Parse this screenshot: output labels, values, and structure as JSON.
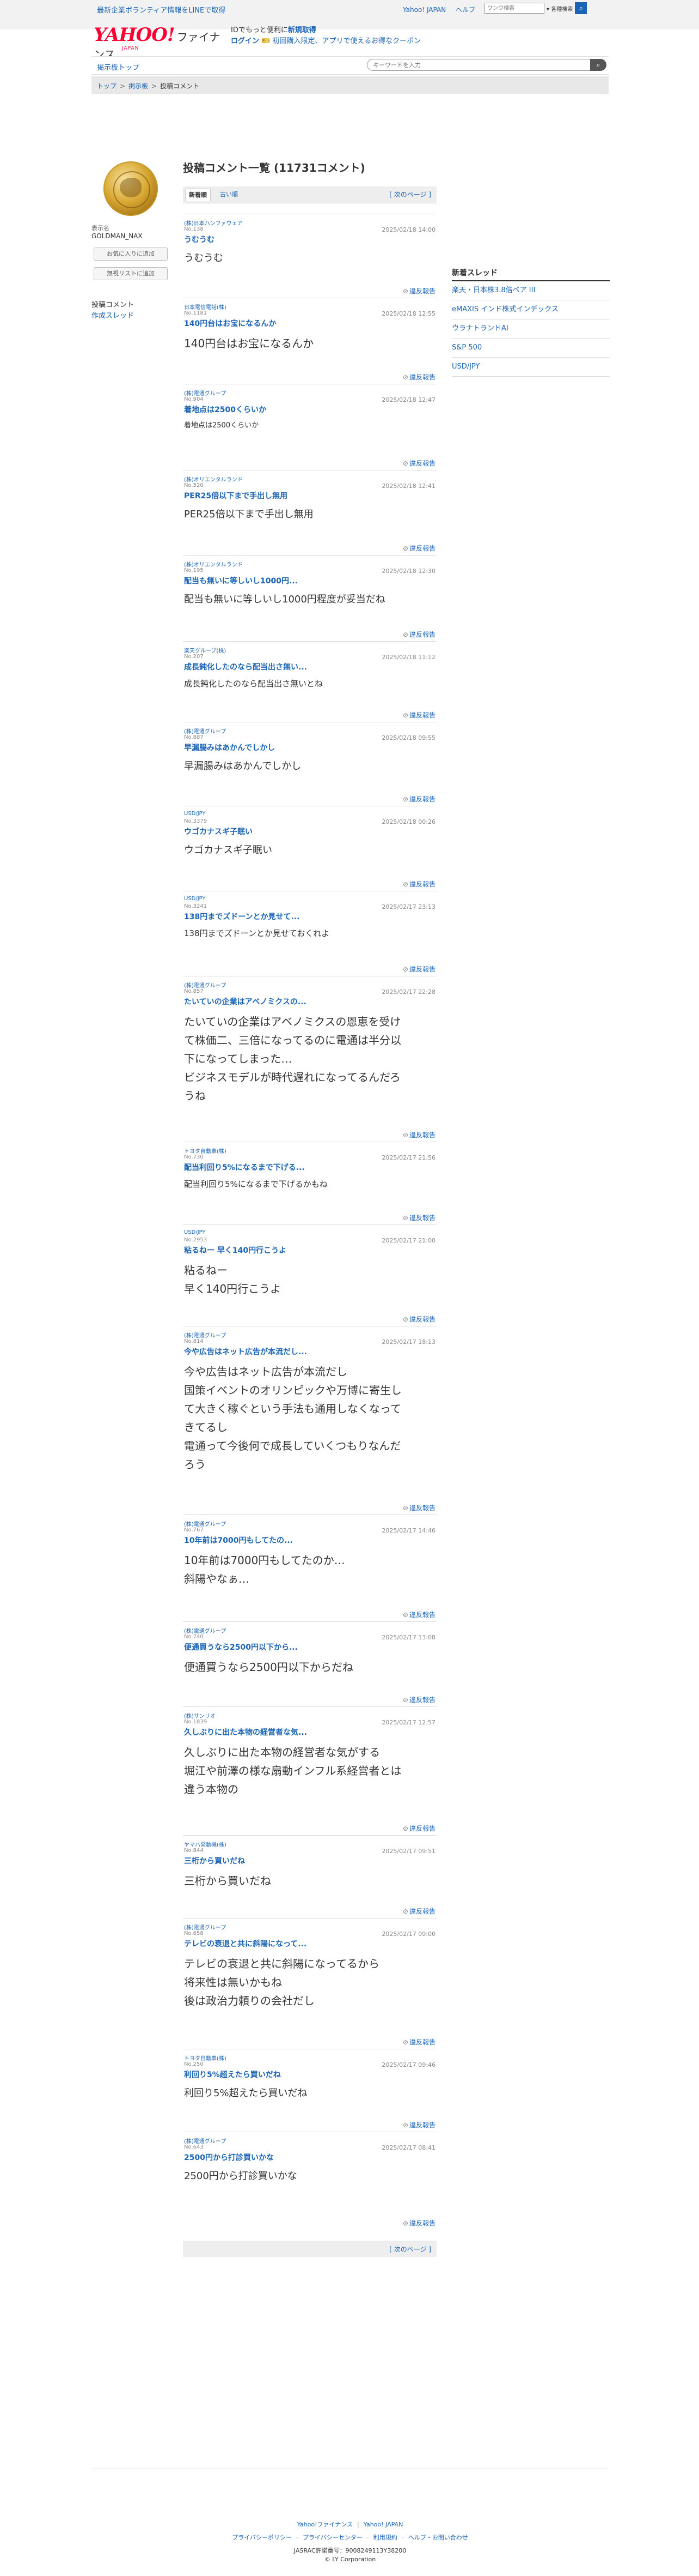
{
  "topbar": {
    "notice": "最新企業ボランティア情報をLINEで取得",
    "links": [
      "Yahoo! JAPAN",
      "ヘルプ"
    ],
    "search_placeholder": "ワンワ検索",
    "search_option": "▾ 各種検索"
  },
  "brand": {
    "logo": "YAHOO!",
    "japan": "JAPAN",
    "product": "ファイナンス"
  },
  "promo": {
    "line1_prefix": "IDでもっと便利に",
    "line1_bold": "新規取得",
    "line2_login": "ログイン",
    "line2_coupon": "初回購入限定、アプリで使えるお得なクーポン"
  },
  "navbar": {
    "home": "掲示板トップ",
    "search_placeholder": "キーワードを入力"
  },
  "breadcrumb": [
    "トップ",
    "掲示板",
    "投稿コメント"
  ],
  "user": {
    "label": "表示名",
    "name": "GOLDMAN_NAX",
    "follow_button": "お気に入りに追加",
    "mute_button": "無視リストに追加",
    "menu_comments": "投稿コメント",
    "menu_threads": "作成スレッド"
  },
  "main": {
    "title": "投稿コメント一覧 (11731コメント)",
    "tab_new": "新着順",
    "tab_old": "古い順",
    "next_page": "[ 次のページ ]",
    "report": "違反報告"
  },
  "posts": [
    {
      "cat": "(株)日本ハンファウェア",
      "no": "No.138",
      "dt": "2025/02/18 14:00",
      "ttl": "うむうむ",
      "body": [
        "うむうむ"
      ]
    },
    {
      "cat": "日本電信電話(株)",
      "no": "No.1181",
      "dt": "2025/02/18 12:55",
      "ttl": "140円台はお宝になるんか",
      "body": [
        "140円台はお宝になるんか"
      ]
    },
    {
      "cat": "(株)電通グループ",
      "no": "No.904",
      "dt": "2025/02/18 12:47",
      "ttl": "着地点は2500くらいか",
      "body": [
        "着地点は2500くらいか"
      ]
    },
    {
      "cat": "(株)オリエンタルランド",
      "no": "No.520",
      "dt": "2025/02/18 12:41",
      "ttl": "PER25倍以下まで手出し無用",
      "body": [
        "PER25倍以下まで手出し無用"
      ]
    },
    {
      "cat": "(株)オリエンタルランド",
      "no": "No.195",
      "dt": "2025/02/18 12:30",
      "ttl": "配当も無いに等しいし1000円...",
      "body": [
        "配当も無いに等しいし1000円程度が妥当だね"
      ]
    },
    {
      "cat": "楽天グループ(株)",
      "no": "No.207",
      "dt": "2025/02/18 11:12",
      "ttl": "成長鈍化したのなら配当出さ無い...",
      "body": [
        "成長鈍化したのなら配当出さ無いとね"
      ]
    },
    {
      "cat": "(株)電通グループ",
      "no": "No.887",
      "dt": "2025/02/18 09:55",
      "ttl": "早漏腸みはあかんでしかし",
      "body": [
        "早漏腸みはあかんでしかし"
      ]
    },
    {
      "cat": "USD/JPY",
      "no": "No.3379",
      "dt": "2025/02/18 00:26",
      "ttl": "ウゴカナスギ子眠い",
      "body": [
        "ウゴカナスギ子眠い"
      ]
    },
    {
      "cat": "USD/JPY",
      "no": "No.3241",
      "dt": "2025/02/17 23:13",
      "ttl": "138円までズドーンとか見せて...",
      "body": [
        "138円までズドーンとか見せておくれよ"
      ]
    },
    {
      "cat": "(株)電通グループ",
      "no": "No.857",
      "dt": "2025/02/17 22:28",
      "ttl": "たいていの企業はアベノミクスの...",
      "body": [
        "たいていの企業はアベノミクスの恩恵を受け",
        "て株価二、三倍になってるのに電通は半分以",
        "下になってしまった…",
        "ビジネスモデルが時代遅れになってるんだろ",
        "うね"
      ]
    },
    {
      "cat": "トヨタ自動車(株)",
      "no": "No.730",
      "dt": "2025/02/17 21:56",
      "ttl": "配当利回り5%になるまで下げる...",
      "body": [
        "配当利回り5%になるまで下げるかもね"
      ]
    },
    {
      "cat": "USD/JPY",
      "no": "No.2953",
      "dt": "2025/02/17 21:00",
      "ttl": "粘るねー 早く140円行こうよ",
      "body": [
        "粘るねー",
        "早く140円行こうよ"
      ]
    },
    {
      "cat": "(株)電通グループ",
      "no": "No.814",
      "dt": "2025/02/17 18:13",
      "ttl": "今や広告はネット広告が本流だし...",
      "body": [
        "今や広告はネット広告が本流だし",
        "国策イベントのオリンピックや万博に寄生し",
        "て大きく稼ぐという手法も通用しなくなって",
        "きてるし",
        "電通って今後何で成長していくつもりなんだ",
        "ろう"
      ]
    },
    {
      "cat": "(株)電通グループ",
      "no": "No.767",
      "dt": "2025/02/17 14:46",
      "ttl": "10年前は7000円もしてたの...",
      "body": [
        "10年前は7000円もしてたのか…",
        "斜陽やなぁ…"
      ]
    },
    {
      "cat": "(株)電通グループ",
      "no": "No.740",
      "dt": "2025/02/17 13:08",
      "ttl": "便通買うなら2500円以下から...",
      "body": [
        "便通買うなら2500円以下からだね"
      ]
    },
    {
      "cat": "(株)サンリオ",
      "no": "No.1839",
      "dt": "2025/02/17 12:57",
      "ttl": "久しぶりに出た本物の経営者な気...",
      "body": [
        "久しぶりに出た本物の経営者な気がする",
        "堀江や前澤の様な扇動インフル系経営者とは",
        "違う本物の"
      ]
    },
    {
      "cat": "ヤマハ発動機(株)",
      "no": "No.844",
      "dt": "2025/02/17 09:51",
      "ttl": "三桁から買いだね",
      "body": [
        "三桁から買いだね"
      ]
    },
    {
      "cat": "(株)電通グループ",
      "no": "No.658",
      "dt": "2025/02/17 09:00",
      "ttl": "テレビの衰退と共に斜陽になって...",
      "body": [
        "テレビの衰退と共に斜陽になってるから",
        "将来性は無いかもね",
        "後は政治力頼りの会社だし"
      ]
    },
    {
      "cat": "トヨタ自動車(株)",
      "no": "No.250",
      "dt": "2025/02/17 09:46",
      "ttl": "利回り5%超えたら買いだね",
      "body": [
        "利回り5%超えたら買いだね"
      ]
    },
    {
      "cat": "(株)電通グループ",
      "no": "No.643",
      "dt": "2025/02/17 08:41",
      "ttl": "2500円から打診買いかな",
      "body": [
        "2500円から打診買いかな"
      ]
    }
  ],
  "sidebar": {
    "title": "新着スレッド",
    "threads": [
      "楽天・日本株3.8倍ベア III",
      "eMAXIS インド株式インデックス",
      "ウラナトランドAI",
      "S&P 500",
      "USD/JPY"
    ]
  },
  "footer": {
    "row1": [
      "Yahoo!ファイナンス",
      "Yahoo! JAPAN"
    ],
    "row2": [
      "プライバシーポリシー",
      "プライバシーセンター",
      "利用規約",
      "ヘルプ・お問い合わせ"
    ],
    "row3": "JASRAC許諾番号：9008249113Y38200",
    "row4": "© LY Corporation"
  },
  "colors": {
    "accent": "#1a63b5",
    "brand_red": "#ff0033",
    "title_bar": "#eeeeee"
  }
}
